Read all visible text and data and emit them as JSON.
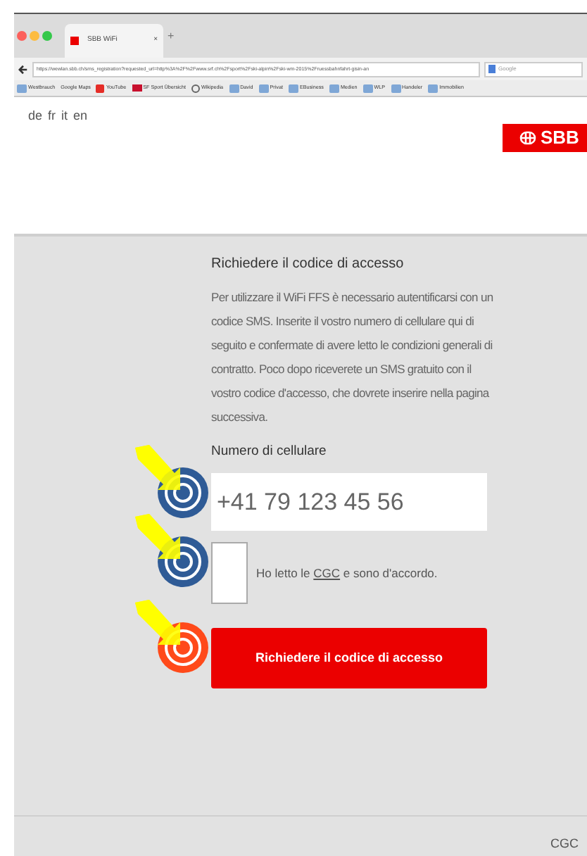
{
  "browser": {
    "tab_title": "SBB WiFi",
    "tab_close": "×",
    "new_tab": "+",
    "url": "https://wewlan.sbb.ch/sms_registration?requested_url=http%3A%2F%2Fwww.srf.ch%2Fsport%2Fski-alpin%2Fski-wm-2015%2Fruessbahnfahrt-gisin-an",
    "search_placeholder": "Google",
    "bookmarks": [
      {
        "label": "Westbrauch",
        "kind": "folder"
      },
      {
        "label": "Google Maps",
        "kind": "plain"
      },
      {
        "label": "YouTube",
        "kind": "youtube"
      },
      {
        "label": "SF Sport Übersicht",
        "kind": "srf"
      },
      {
        "label": "Wikipedia",
        "kind": "wiki"
      },
      {
        "label": "David",
        "kind": "folder"
      },
      {
        "label": "Privat",
        "kind": "folder"
      },
      {
        "label": "EBusiness",
        "kind": "folder"
      },
      {
        "label": "Medien",
        "kind": "folder"
      },
      {
        "label": "WLP",
        "kind": "folder"
      },
      {
        "label": "Handeler",
        "kind": "folder"
      },
      {
        "label": "Immobilien",
        "kind": "folder"
      }
    ]
  },
  "languages": [
    {
      "label": "de"
    },
    {
      "label": "fr"
    },
    {
      "label": "it"
    },
    {
      "label": "en"
    }
  ],
  "logo": {
    "text": "SBB"
  },
  "form": {
    "title": "Richiedere il codice di accesso",
    "intro": "Per utilizzare il WiFi FFS è necessario autentificarsi con un codice SMS. Inserite il vostro numero di cellulare qui di seguito e confermate di avere letto le condizioni generali di contratto. Poco dopo riceverete un SMS gratuito con il vostro codice d'accesso, che dovrete inserire nella pagina successiva.",
    "phone_label": "Numero di cellulare",
    "phone_value": "+41 79 123 45 56",
    "consent_before": "Ho letto le",
    "consent_link": "CGC",
    "consent_after": "e sono d'accordo.",
    "consent_checked": false,
    "submit": "Richiedere il codice di accesso"
  },
  "markers": [
    {
      "color": "#2f5b96"
    },
    {
      "color": "#2f5b96"
    },
    {
      "color": "#ff4a1a"
    }
  ],
  "footer": {
    "links": [
      {
        "label": "CGC"
      }
    ]
  }
}
